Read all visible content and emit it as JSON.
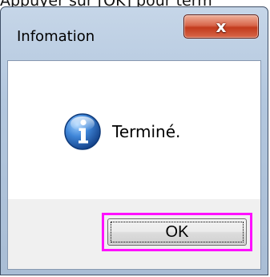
{
  "instruction": {
    "text": "Appuyer sur [OK] pour term"
  },
  "dialog": {
    "title": "Infomation",
    "close_glyph": "x",
    "message": "Terminé.",
    "icon": "information-icon",
    "ok_label": "OK"
  },
  "colors": {
    "highlight": "#ff10ff",
    "close_button": "#c23a1c",
    "title_bar": "#b3c7de",
    "info_icon_blue": "#1f5fb0"
  }
}
